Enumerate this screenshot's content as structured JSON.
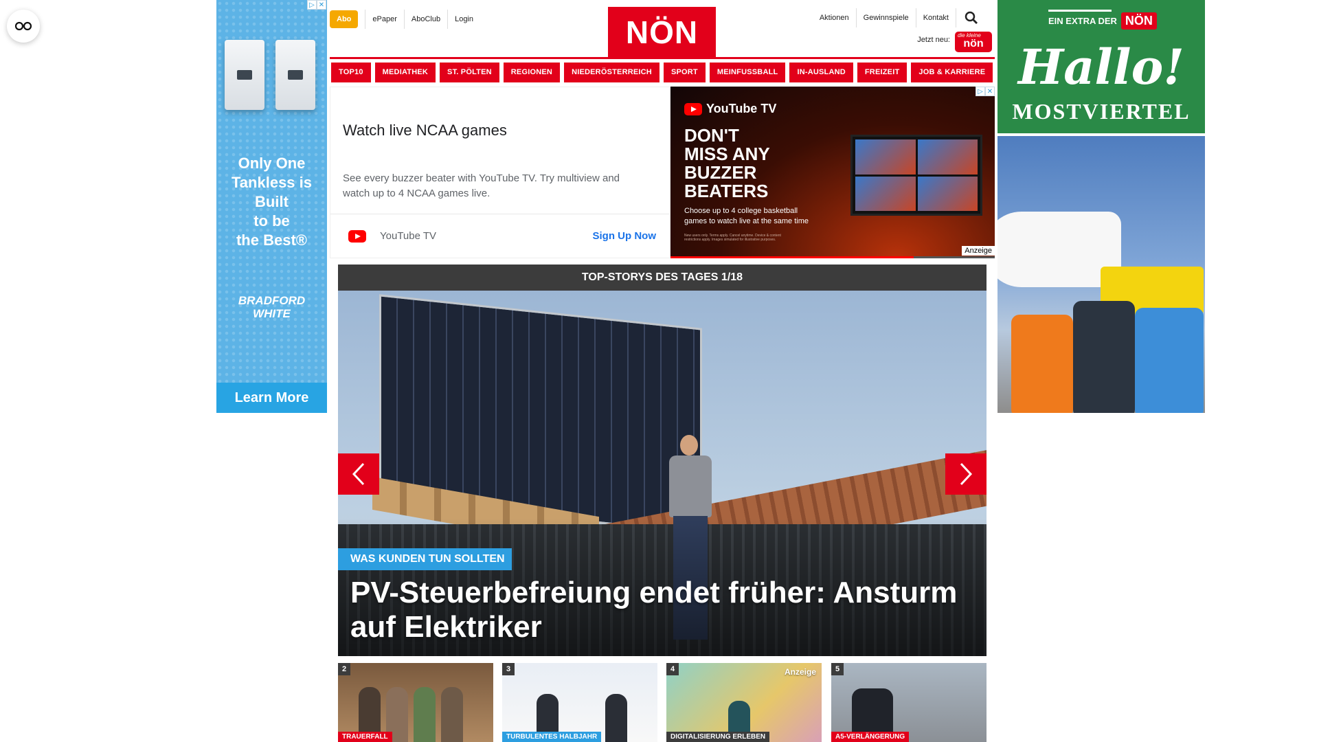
{
  "ads": {
    "left": {
      "tagline": "Only One\nTankless is\nBuilt\nto be\nthe Best®",
      "brand": "BRADFORD\nWHITE",
      "cta": "Learn More"
    },
    "youtube": {
      "title": "Watch live NCAA games",
      "description": "See every buzzer beater with YouTube TV. Try multiview and watch up to 4 NCAA games live.",
      "brand": "YouTube TV",
      "cta": "Sign Up Now",
      "banner_logo": "YouTube TV",
      "banner_headline": "DON'T\nMISS ANY\nBUZZER\nBEATERS",
      "banner_sub": "Choose up to 4 college basketball games to watch live at the same time",
      "banner_fine": "New users only. Terms apply. Cancel anytime. Device & content restrictions apply. Images simulated for illustrative purposes.",
      "banner_progress": 0.75,
      "anzeige": "Anzeige"
    },
    "right": {
      "extra_label": "EIN EXTRA DER",
      "extra_brand": "NÖN",
      "hallo": "Hallo!",
      "region": "MOSTVIERTEL"
    }
  },
  "header": {
    "abo": "Abo",
    "left_links": [
      "ePaper",
      "AboClub",
      "Login"
    ],
    "logo": "NÖN",
    "right_links": [
      "Aktionen",
      "Gewinnspiele",
      "Kontakt"
    ],
    "jetzt_neu": "Jetzt neu:",
    "jetzt_badge_small": "die kleine",
    "jetzt_badge": "nön",
    "accent_color": "#e2001a"
  },
  "nav": [
    "TOP10",
    "MEDIATHEK",
    "ST. PÖLTEN",
    "REGIONEN",
    "NIEDERÖSTERREICH",
    "SPORT",
    "MEINFUSSBALL",
    "IN-AUSLAND",
    "FREIZEIT",
    "JOB & KARRIERE"
  ],
  "top_stories": {
    "heading": "TOP-STORYS DES TAGES 1/18",
    "kicker": "WAS KUNDEN TUN SOLLTEN",
    "headline": "PV-Steuerbefreiung endet früher: Ansturm auf Elektriker",
    "thumbs": [
      {
        "num": "2",
        "label": "TRAUERFALL"
      },
      {
        "num": "3",
        "label": "TURBULENTES HALBJAHR"
      },
      {
        "num": "4",
        "label": "DIGITALISIERUNG ERLEBEN",
        "anzeige": "Anzeige"
      },
      {
        "num": "5",
        "label": "A5-VERLÄNGERUNG"
      }
    ]
  }
}
